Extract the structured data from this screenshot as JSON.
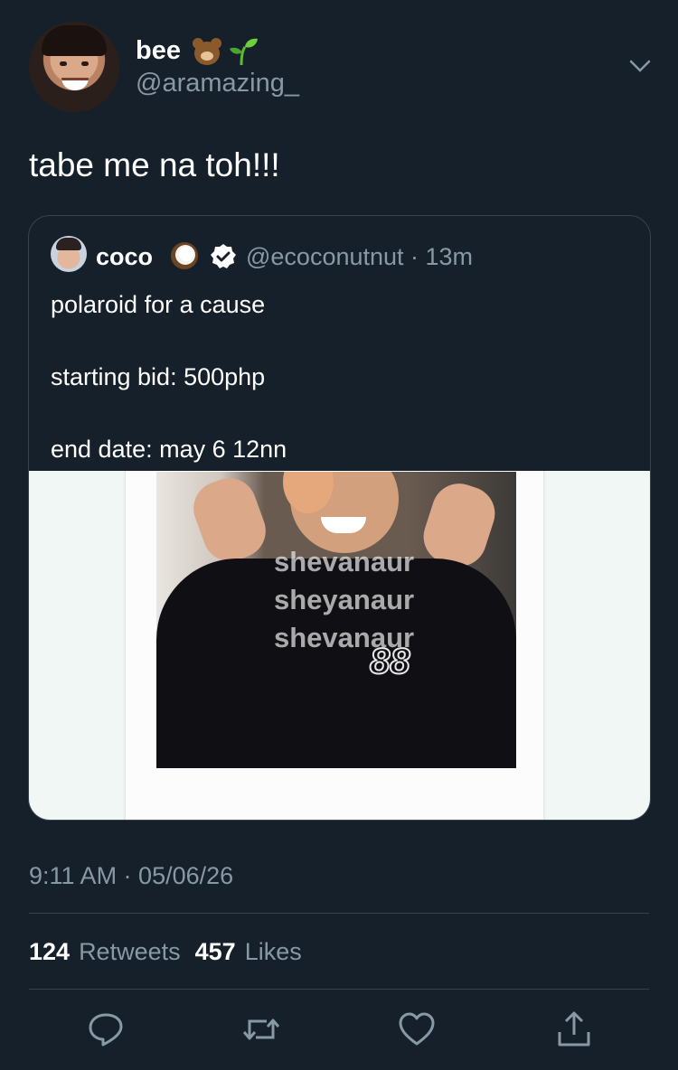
{
  "author": {
    "display_name": "bee",
    "name_emojis": [
      "bear-face-icon",
      "seedling-icon"
    ],
    "handle": "@aramazing_"
  },
  "tweet": {
    "text": "tabe me na toh!!!",
    "timestamp": "9:11 AM · 05/06/26"
  },
  "quoted_tweet": {
    "display_name": "coco",
    "name_emoji": "coconut-icon",
    "verified": true,
    "handle_time": "@ecoconutnut · 13m",
    "lines": [
      "polaroid for a cause",
      "starting bid: 500php",
      "end date: may 6 12nn"
    ],
    "photo": {
      "watermarks": [
        "shevanaur",
        "sheyanaur",
        "shevanaur"
      ],
      "jersey_number": "88"
    }
  },
  "stats": {
    "retweets_count": "124",
    "retweets_label": "Retweets",
    "likes_count": "457",
    "likes_label": "Likes"
  },
  "actions": [
    "reply-icon",
    "retweet-icon",
    "like-icon",
    "share-icon"
  ],
  "colors": {
    "background": "#15202b",
    "secondary_text": "#8899a6",
    "border": "#38444d",
    "verified": "#ffffff"
  }
}
